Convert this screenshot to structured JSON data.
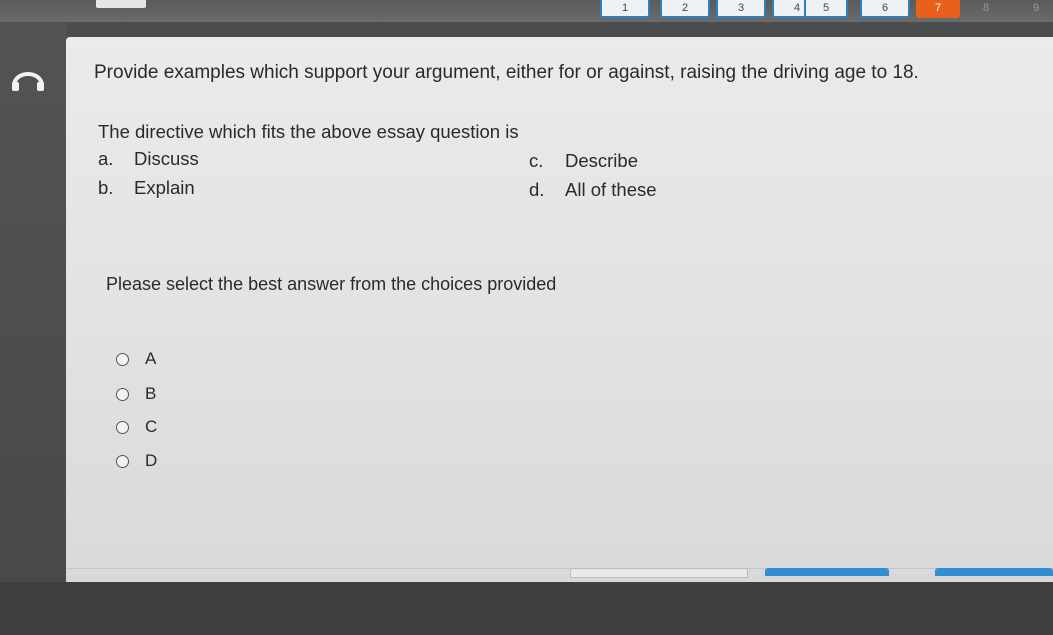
{
  "tabs": {
    "items": [
      {
        "label": "1",
        "state": "normal"
      },
      {
        "label": "2",
        "state": "normal"
      },
      {
        "label": "3",
        "state": "normal"
      },
      {
        "label": "4",
        "state": "normal"
      },
      {
        "label": "5",
        "state": "normal"
      },
      {
        "label": "6",
        "state": "normal"
      },
      {
        "label": "7",
        "state": "active"
      },
      {
        "label": "8",
        "state": "plain"
      },
      {
        "label": "9",
        "state": "plain"
      }
    ]
  },
  "sidebar": {
    "icon": "headphones-icon"
  },
  "question": {
    "prompt": "Provide examples which support your argument, either for or against, raising the driving age to 18.",
    "directive": "The directive which fits the above essay question is",
    "options": [
      {
        "letter": "a.",
        "text": "Discuss"
      },
      {
        "letter": "b.",
        "text": "Explain"
      },
      {
        "letter": "c.",
        "text": "Describe"
      },
      {
        "letter": "d.",
        "text": "All of these"
      }
    ],
    "instruction": "Please select the best answer from the choices provided",
    "choices": [
      "A",
      "B",
      "C",
      "D"
    ]
  },
  "colors": {
    "accent": "#e8601e",
    "tab_border": "#2f7fbf",
    "bottom_buttons": [
      "#e9e9e9",
      "#2f8fd0",
      "#2f8fd0"
    ]
  }
}
